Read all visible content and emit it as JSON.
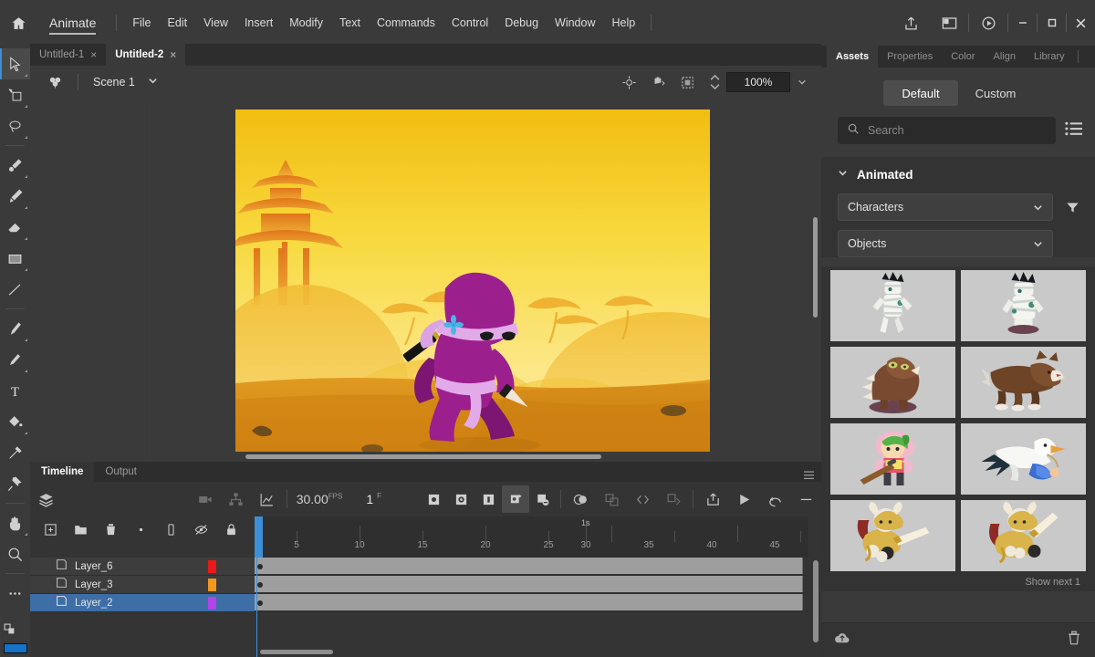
{
  "app": {
    "home_icon": "home-icon",
    "name": "Animate",
    "menus": [
      "File",
      "Edit",
      "View",
      "Insert",
      "Modify",
      "Text",
      "Commands",
      "Control",
      "Debug",
      "Window",
      "Help"
    ],
    "right_icons": [
      "share-icon",
      "workspace-icon",
      "publish-preview-icon"
    ],
    "window_controls": {
      "minimize": "minimize-icon",
      "maximize": "maximize-icon",
      "close": "close-icon"
    }
  },
  "doc_tabs": [
    {
      "label": "Untitled-1",
      "active": false,
      "close": "×"
    },
    {
      "label": "Untitled-2",
      "active": true,
      "close": "×"
    }
  ],
  "scene_bar": {
    "symbol_icon": "edit-symbols-icon",
    "scene_label": "Scene 1",
    "scene_chevron": "chevron-down-icon",
    "tools": [
      "center-stage-icon",
      "rotate-stage-icon",
      "clip-to-stage-icon"
    ],
    "zoom_value": "100%",
    "zoom_chevron": "chevron-down-icon"
  },
  "tools": [
    {
      "name": "selection-tool",
      "icon": "arrow-cursor-icon",
      "active": true
    },
    {
      "name": "free-transform-tool",
      "icon": "free-transform-icon",
      "active": false
    },
    {
      "name": "lasso-tool",
      "icon": "lasso-icon",
      "active": false
    },
    {
      "name": "brush-tool",
      "icon": "paint-brush-icon",
      "active": false
    },
    {
      "name": "classic-brush-tool",
      "icon": "brush-icon",
      "active": false
    },
    {
      "name": "eraser-tool",
      "icon": "eraser-icon",
      "active": false
    },
    {
      "name": "rectangle-tool",
      "icon": "rectangle-icon",
      "active": false
    },
    {
      "name": "line-tool",
      "icon": "line-icon",
      "active": false
    },
    {
      "name": "pen-tool",
      "icon": "pen-icon",
      "active": false
    },
    {
      "name": "pencil-tool",
      "icon": "pencil-icon",
      "active": false
    },
    {
      "name": "text-tool",
      "icon": "text-T-icon",
      "active": false
    },
    {
      "name": "paint-bucket-tool",
      "icon": "paint-bucket-icon",
      "active": false
    },
    {
      "name": "eyedropper-tool",
      "icon": "eyedropper-icon",
      "active": false
    },
    {
      "name": "bone-tool",
      "icon": "pin-icon",
      "active": false
    },
    {
      "name": "hand-tool",
      "icon": "hand-icon",
      "active": false
    },
    {
      "name": "zoom-tool",
      "icon": "magnifier-icon",
      "active": false
    },
    {
      "name": "more-tools",
      "icon": "ellipsis-icon",
      "active": false
    }
  ],
  "stage": {
    "artwork_title": "ninja-character-sunset-scene",
    "background_colors": {
      "sky_top": "#f5c518",
      "sky_mid": "#f8dd55",
      "sky_low": "#fbe98a",
      "ground": "#dd8f1a",
      "ground_dark": "#c97f14",
      "pagoda": "#e07b1c",
      "hill": "#f0b93a"
    },
    "character_colors": {
      "body": "#9c1f8e",
      "body_dark": "#7d1572",
      "scarf": "#e0a8e8",
      "sword_handle": "#1a1a1a",
      "blade": "#f2eadf",
      "flower": "#49b6e8"
    }
  },
  "timeline": {
    "tabs": [
      {
        "label": "Timeline",
        "active": true
      },
      {
        "label": "Output",
        "active": false
      }
    ],
    "menu_icon": "panel-menu-icon",
    "layers_icon": "layers-icon",
    "camera_icon": "camera-icon",
    "parenting_icon": "parenting-view-icon",
    "graph_editor_icon": "graph-editor-icon",
    "fps": "30.00",
    "fps_unit": "FPS",
    "current_frame": "1",
    "frame_unit": "F",
    "keyframe_tools": [
      {
        "name": "insert-keyframe",
        "icon": "keyframe-solid-icon",
        "on": false
      },
      {
        "name": "insert-blank-keyframe",
        "icon": "keyframe-hollow-icon",
        "on": false
      },
      {
        "name": "insert-frame",
        "icon": "frame-icon",
        "on": false
      },
      {
        "name": "create-classic-tween",
        "icon": "classic-tween-icon",
        "on": true
      },
      {
        "name": "remove-tween",
        "icon": "remove-tween-icon",
        "on": false
      }
    ],
    "playback_tools": [
      {
        "name": "onion-skin",
        "icon": "onion-skin-icon"
      },
      {
        "name": "onion-skin-outline",
        "icon": "onion-outline-icon"
      },
      {
        "name": "edit-multiple-frames",
        "icon": "edit-multiple-icon"
      },
      {
        "name": "modify-onion-markers",
        "icon": "onion-markers-icon"
      }
    ],
    "right_tools": [
      {
        "name": "export-video",
        "icon": "export-icon"
      },
      {
        "name": "play",
        "icon": "play-icon"
      },
      {
        "name": "loop-playback",
        "icon": "loop-icon"
      },
      {
        "name": "collapse-panel",
        "icon": "minus-icon"
      }
    ],
    "layer_tools": [
      {
        "name": "new-layer",
        "icon": "plus-square-icon"
      },
      {
        "name": "new-folder",
        "icon": "folder-icon"
      },
      {
        "name": "delete-layer",
        "icon": "trash-icon"
      },
      {
        "name": "show-hide-dots",
        "icon": "dot-icon"
      },
      {
        "name": "layer-depth",
        "icon": "layer-depth-icon"
      },
      {
        "name": "hide-all-layers",
        "icon": "eye-off-icon"
      },
      {
        "name": "lock-all-layers",
        "icon": "lock-icon"
      }
    ],
    "layers": [
      {
        "name": "Layer_6",
        "color": "#e81a1a",
        "selected": false,
        "span_frames": 50,
        "keyframe": true
      },
      {
        "name": "Layer_3",
        "color": "#f09a1e",
        "selected": false,
        "span_frames": 50,
        "keyframe": true
      },
      {
        "name": "Layer_2",
        "color": "#b344e8",
        "selected": true,
        "span_frames": 50,
        "keyframe": true
      }
    ],
    "ruler": {
      "numbers": [
        "5",
        "10",
        "15",
        "20",
        "25",
        "30",
        "35",
        "40",
        "45"
      ],
      "second_marker": "1s",
      "playhead_frame": 1
    }
  },
  "right_panel": {
    "tabs": [
      {
        "label": "Assets",
        "active": true
      },
      {
        "label": "Properties",
        "active": false
      },
      {
        "label": "Color",
        "active": false
      },
      {
        "label": "Align",
        "active": false
      },
      {
        "label": "Library",
        "active": false
      }
    ],
    "mode_toggle": [
      {
        "label": "Default",
        "active": true
      },
      {
        "label": "Custom",
        "active": false
      }
    ],
    "search": {
      "placeholder": "Search",
      "value": "",
      "icon": "search-icon"
    },
    "list_view_icon": "list-view-icon",
    "section": {
      "label": "Animated",
      "chevron": "chevron-down-icon",
      "expanded": true
    },
    "filters": [
      {
        "label": "Characters",
        "chevron": "chevron-down-icon"
      },
      {
        "label": "Objects",
        "chevron": "chevron-down-icon"
      }
    ],
    "filter_icon": "funnel-icon",
    "assets": [
      {
        "name": "mummy-walking",
        "type": "mummy"
      },
      {
        "name": "mummy-idle",
        "type": "mummy2"
      },
      {
        "name": "dino-monster",
        "type": "dino"
      },
      {
        "name": "brown-wolf",
        "type": "wolf"
      },
      {
        "name": "green-hair-warrior",
        "type": "warrior"
      },
      {
        "name": "stork-with-bundle",
        "type": "stork"
      },
      {
        "name": "golden-knight-left",
        "type": "knight"
      },
      {
        "name": "golden-knight-right",
        "type": "knight2"
      }
    ],
    "show_next": "Show next 1",
    "bottom_tools": [
      {
        "name": "upload-asset",
        "icon": "cloud-upload-icon"
      },
      {
        "name": "delete-asset",
        "icon": "trash-icon"
      }
    ]
  }
}
